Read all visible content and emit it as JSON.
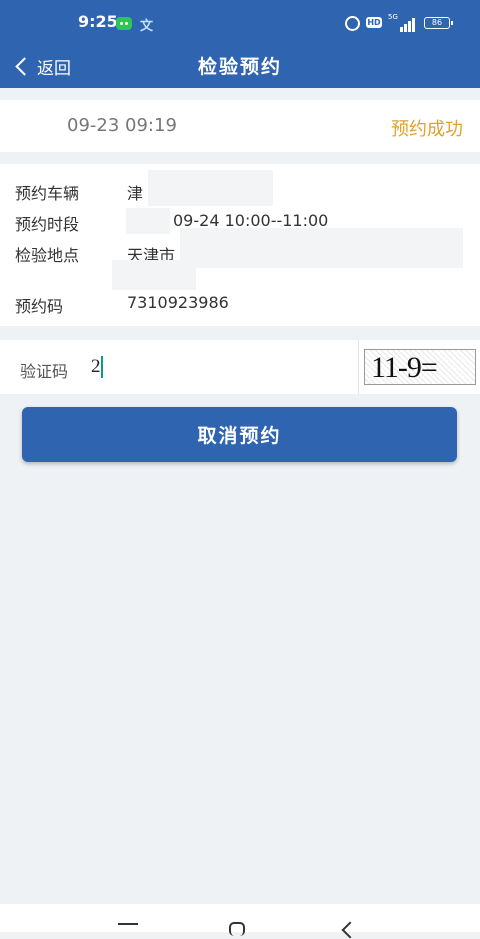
{
  "status_bar": {
    "time": "9:25",
    "app_icon_glyph": "文",
    "hd_label": "HD",
    "network_label": "5G",
    "battery": "86"
  },
  "nav": {
    "back_label": "返回",
    "title": "检验预约"
  },
  "summary": {
    "date": "09-23 09:19",
    "status": "预约成功",
    "status_color": "#e0a32a"
  },
  "details": {
    "vehicle_label": "预约车辆",
    "vehicle_value": "津",
    "time_label": "预约时段",
    "time_value": "09-24 10:00--11:00",
    "location_label": "检验地点",
    "location_value": "天津市",
    "code_label": "预约码",
    "code_value": "7310923986"
  },
  "captcha": {
    "label": "验证码",
    "input_value": "2",
    "image_text": "11-9="
  },
  "actions": {
    "cancel_label": "取消预约"
  },
  "colors": {
    "primary": "#2f64b0",
    "background": "#eef2f5",
    "success": "#e0a32a"
  }
}
